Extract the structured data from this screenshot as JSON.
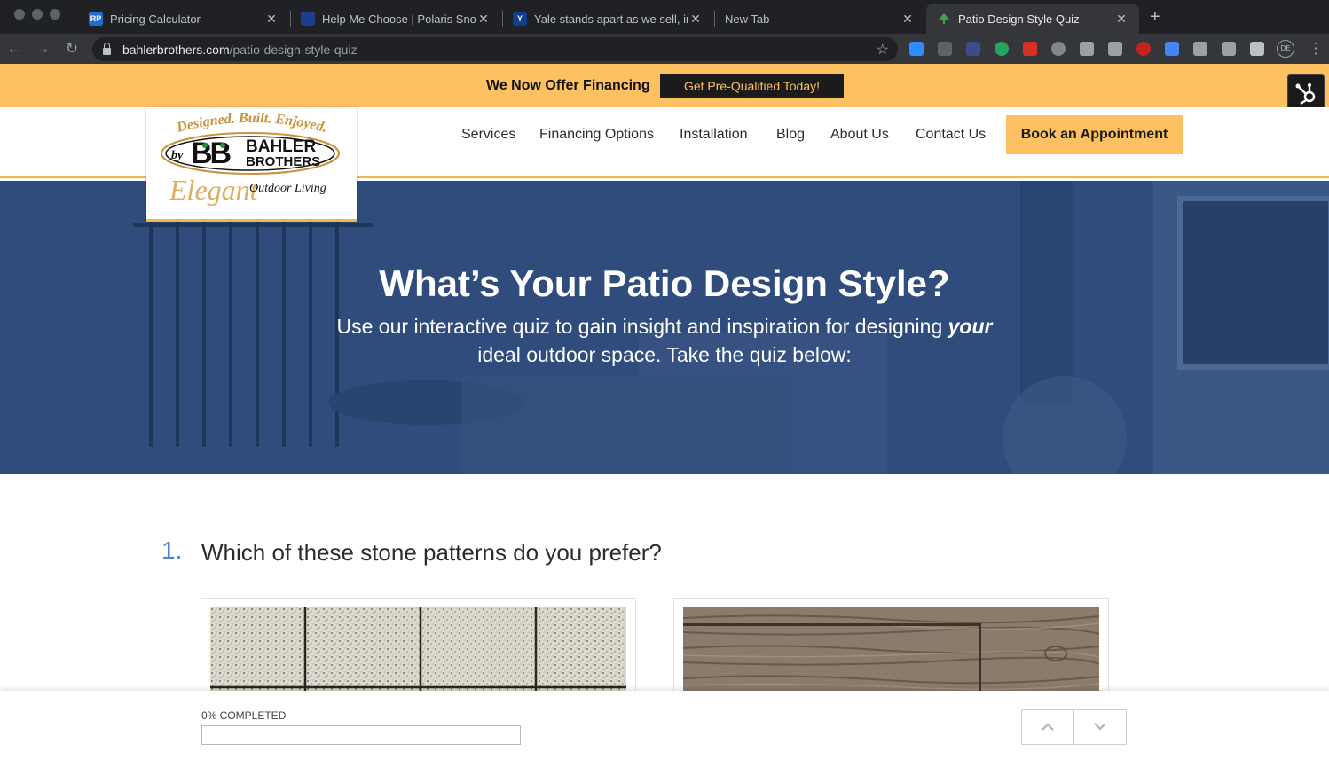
{
  "browser": {
    "tabs": [
      {
        "title": "Pricing Calculator",
        "favicon": "rp-icon",
        "active": false
      },
      {
        "title": "Help Me Choose | Polaris Snow",
        "favicon": "polaris-icon",
        "active": false
      },
      {
        "title": "Yale stands apart as we sell, in",
        "favicon": "yale-icon",
        "active": false
      },
      {
        "title": "New Tab",
        "favicon": "",
        "active": false
      },
      {
        "title": "Patio Design Style Quiz",
        "favicon": "tree-icon",
        "active": true
      }
    ],
    "url_host": "bahlerbrothers.com",
    "url_path": "/patio-design-style-quiz",
    "profile_initials": "DE",
    "favicon_labels": {
      "rp": "RP",
      "yale": "Y"
    }
  },
  "promo": {
    "text": "We Now Offer Financing",
    "button": "Get Pre-Qualified Today!"
  },
  "logo": {
    "tagline": "Designed. Built. Enjoyed.",
    "by": "by",
    "monogram": "BB",
    "line1": "BAHLER",
    "line2": "BROTHERS",
    "script": "Elegant",
    "outdoor": "Outdoor Living"
  },
  "nav": {
    "items": [
      "Services",
      "Financing Options",
      "Installation",
      "Blog",
      "About Us",
      "Contact Us"
    ],
    "cta": "Book an Appointment"
  },
  "hero": {
    "title": "What’s Your Patio Design Style?",
    "subtitle_before": "Use our interactive quiz to gain insight and inspiration for designing ",
    "subtitle_emphasis": "your",
    "subtitle_after": " ideal outdoor space. Take the quiz below:"
  },
  "quiz": {
    "question_number": "1.",
    "question_text": "Which of these stone patterns do you prefer?",
    "progress_label": "0% COMPLETED",
    "progress_percent": 0
  },
  "colors": {
    "accent": "#fdc162",
    "hero_overlay": "#2e4a78",
    "question_number": "#4a86c5"
  }
}
